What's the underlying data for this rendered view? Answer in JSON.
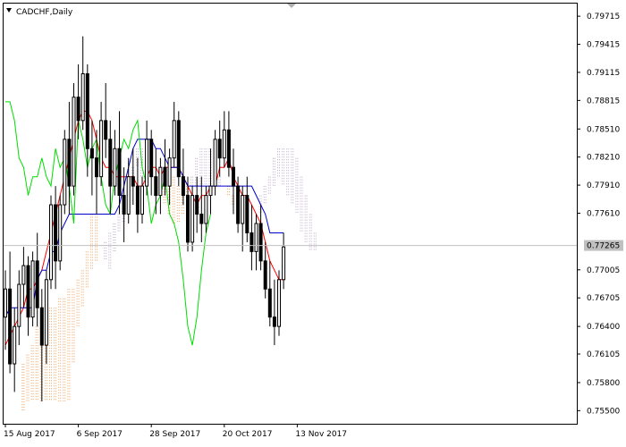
{
  "window": {
    "title": "CADCHF,Daily",
    "menu_icon": "triangle-down-icon",
    "scroll_marker_icon": "triangle-down-icon"
  },
  "colors": {
    "background": "#ffffff",
    "frame": "#000000",
    "candle": "#000000",
    "tenkan": "#ff0000",
    "kijun": "#0000cc",
    "chikou": "#00dd00",
    "cloud_bull": "#f0a060",
    "cloud_bear": "#b8a8c8",
    "bid_line": "#c0c0c0",
    "price_label_bg": "#c0c0c0"
  },
  "chart_data": {
    "type": "candlestick",
    "title": "CADCHF,Daily",
    "ylim": [
      0.7536,
      0.7985
    ],
    "y_ticks": [
      0.79715,
      0.79415,
      0.79115,
      0.78815,
      0.7851,
      0.7821,
      0.7791,
      0.7761,
      0.77005,
      0.76705,
      0.764,
      0.76105,
      0.758,
      0.755
    ],
    "current_price_label": "0.77265",
    "current_price": 0.77265,
    "x_labels": [
      "15 Aug 2017",
      "6 Sep 2017",
      "28 Sep 2017",
      "20 Oct 2017",
      "13 Nov 2017"
    ],
    "x_label_indices": [
      0,
      16,
      32,
      48,
      64
    ],
    "candles": [
      [
        0.765,
        0.77,
        0.7615,
        0.768
      ],
      [
        0.768,
        0.772,
        0.759,
        0.76
      ],
      [
        0.76,
        0.766,
        0.757,
        0.764
      ],
      [
        0.764,
        0.77,
        0.762,
        0.7685
      ],
      [
        0.7685,
        0.7725,
        0.766,
        0.7705
      ],
      [
        0.7705,
        0.7715,
        0.763,
        0.765
      ],
      [
        0.765,
        0.772,
        0.764,
        0.771
      ],
      [
        0.771,
        0.774,
        0.764,
        0.766
      ],
      [
        0.766,
        0.768,
        0.756,
        0.762
      ],
      [
        0.762,
        0.77,
        0.76,
        0.769
      ],
      [
        0.769,
        0.778,
        0.768,
        0.777
      ],
      [
        0.777,
        0.779,
        0.768,
        0.771
      ],
      [
        0.771,
        0.778,
        0.77,
        0.777
      ],
      [
        0.777,
        0.785,
        0.776,
        0.784
      ],
      [
        0.784,
        0.788,
        0.776,
        0.779
      ],
      [
        0.779,
        0.79,
        0.778,
        0.7885
      ],
      [
        0.7885,
        0.792,
        0.784,
        0.786
      ],
      [
        0.786,
        0.795,
        0.785,
        0.791
      ],
      [
        0.791,
        0.792,
        0.78,
        0.783
      ],
      [
        0.783,
        0.786,
        0.778,
        0.782
      ],
      [
        0.782,
        0.785,
        0.776,
        0.78
      ],
      [
        0.78,
        0.788,
        0.779,
        0.786
      ],
      [
        0.786,
        0.79,
        0.782,
        0.784
      ],
      [
        0.784,
        0.786,
        0.776,
        0.779
      ],
      [
        0.779,
        0.785,
        0.778,
        0.783
      ],
      [
        0.783,
        0.787,
        0.776,
        0.778
      ],
      [
        0.778,
        0.781,
        0.773,
        0.776
      ],
      [
        0.776,
        0.782,
        0.775,
        0.78
      ],
      [
        0.78,
        0.783,
        0.777,
        0.779
      ],
      [
        0.779,
        0.782,
        0.774,
        0.776
      ],
      [
        0.776,
        0.78,
        0.775,
        0.779
      ],
      [
        0.779,
        0.786,
        0.778,
        0.784
      ],
      [
        0.784,
        0.785,
        0.778,
        0.78
      ],
      [
        0.78,
        0.783,
        0.776,
        0.778
      ],
      [
        0.778,
        0.782,
        0.776,
        0.781
      ],
      [
        0.781,
        0.784,
        0.778,
        0.779
      ],
      [
        0.779,
        0.783,
        0.777,
        0.782
      ],
      [
        0.782,
        0.788,
        0.781,
        0.786
      ],
      [
        0.786,
        0.787,
        0.779,
        0.78
      ],
      [
        0.78,
        0.783,
        0.777,
        0.778
      ],
      [
        0.778,
        0.78,
        0.772,
        0.773
      ],
      [
        0.773,
        0.779,
        0.772,
        0.778
      ],
      [
        0.778,
        0.78,
        0.774,
        0.776
      ],
      [
        0.776,
        0.78,
        0.773,
        0.775
      ],
      [
        0.775,
        0.779,
        0.774,
        0.778
      ],
      [
        0.778,
        0.783,
        0.776,
        0.779
      ],
      [
        0.779,
        0.785,
        0.778,
        0.784
      ],
      [
        0.784,
        0.786,
        0.78,
        0.782
      ],
      [
        0.782,
        0.787,
        0.781,
        0.785
      ],
      [
        0.785,
        0.787,
        0.78,
        0.781
      ],
      [
        0.781,
        0.783,
        0.776,
        0.779
      ],
      [
        0.779,
        0.78,
        0.774,
        0.775
      ],
      [
        0.775,
        0.779,
        0.772,
        0.778
      ],
      [
        0.778,
        0.78,
        0.773,
        0.774
      ],
      [
        0.774,
        0.777,
        0.77,
        0.772
      ],
      [
        0.772,
        0.776,
        0.77,
        0.775
      ],
      [
        0.775,
        0.777,
        0.77,
        0.771
      ],
      [
        0.771,
        0.773,
        0.767,
        0.768
      ],
      [
        0.768,
        0.771,
        0.764,
        0.765
      ],
      [
        0.765,
        0.769,
        0.762,
        0.764
      ],
      [
        0.764,
        0.77,
        0.763,
        0.769
      ],
      [
        0.769,
        0.774,
        0.768,
        0.7725
      ]
    ],
    "series": [
      {
        "key": "tenkan",
        "values": [
          0.762,
          0.763,
          0.764,
          0.765,
          0.766,
          0.768,
          0.768,
          0.769,
          0.77,
          0.772,
          0.774,
          0.776,
          0.778,
          0.78,
          0.782,
          0.784,
          0.786,
          0.787,
          0.787,
          0.786,
          0.784,
          0.782,
          0.781,
          0.781,
          0.78,
          0.78,
          0.78,
          0.78,
          0.78,
          0.779,
          0.779,
          0.78,
          0.781,
          0.781,
          0.78,
          0.781,
          0.781,
          0.781,
          0.781,
          0.78,
          0.779,
          0.778,
          0.777,
          0.778,
          0.778,
          0.779,
          0.779,
          0.781,
          0.781,
          0.782,
          0.78,
          0.779,
          0.778,
          0.778,
          0.777,
          0.776,
          0.775,
          0.773,
          0.771,
          0.77,
          0.769,
          0.769
        ]
      },
      {
        "key": "kijun",
        "values": [
          0.765,
          0.766,
          0.766,
          0.766,
          0.766,
          0.766,
          0.766,
          0.769,
          0.77,
          0.77,
          0.772,
          0.772,
          0.774,
          0.775,
          0.776,
          0.776,
          0.776,
          0.776,
          0.776,
          0.776,
          0.776,
          0.776,
          0.776,
          0.776,
          0.776,
          0.777,
          0.779,
          0.781,
          0.783,
          0.784,
          0.784,
          0.784,
          0.784,
          0.783,
          0.783,
          0.782,
          0.781,
          0.781,
          0.781,
          0.78,
          0.779,
          0.779,
          0.779,
          0.779,
          0.779,
          0.779,
          0.779,
          0.779,
          0.779,
          0.779,
          0.779,
          0.779,
          0.779,
          0.779,
          0.779,
          0.778,
          0.777,
          0.776,
          0.774,
          0.774,
          0.774,
          0.774
        ]
      },
      {
        "key": "chikou",
        "values": [
          0.788,
          0.788,
          0.786,
          0.782,
          0.781,
          0.778,
          0.78,
          0.78,
          0.782,
          0.78,
          0.779,
          0.783,
          0.781,
          0.782,
          0.779,
          0.775,
          0.786,
          0.784,
          0.781,
          0.783,
          0.784,
          0.78,
          0.777,
          0.776,
          0.78,
          0.782,
          0.784,
          0.783,
          0.785,
          0.786,
          0.781,
          0.779,
          0.775,
          0.777,
          0.778,
          0.78,
          0.776,
          0.775,
          0.773,
          0.769,
          0.764,
          0.762,
          0.765,
          0.77,
          0.774,
          0.776
        ]
      }
    ],
    "cloud": {
      "start_index": 4,
      "senkou_a": [
        0.76,
        0.761,
        0.762,
        0.764,
        0.765,
        0.766,
        0.766,
        0.766,
        0.767,
        0.767,
        0.768,
        0.768,
        0.769,
        0.77,
        0.772,
        0.776,
        0.776,
        0.772,
        0.771,
        0.77,
        0.772,
        0.774,
        0.775,
        0.778,
        0.78,
        0.781,
        0.78,
        0.78,
        0.78,
        0.78,
        0.78,
        0.781,
        0.781,
        0.78,
        0.779,
        0.779,
        0.779,
        0.779,
        0.779,
        0.779,
        0.779,
        0.779,
        0.779,
        0.779,
        0.779,
        0.779,
        0.778,
        0.778,
        0.777,
        0.776,
        0.776,
        0.776,
        0.776,
        0.777,
        0.778,
        0.779,
        0.78,
        0.779,
        0.778,
        0.777,
        0.776,
        0.774,
        0.773,
        0.772,
        0.772,
        0.773
      ],
      "senkou_b": [
        0.755,
        0.756,
        0.756,
        0.756,
        0.756,
        0.756,
        0.756,
        0.756,
        0.756,
        0.756,
        0.756,
        0.76,
        0.764,
        0.766,
        0.768,
        0.77,
        0.771,
        0.772,
        0.773,
        0.774,
        0.775,
        0.776,
        0.777,
        0.779,
        0.781,
        0.783,
        0.783,
        0.781,
        0.78,
        0.779,
        0.778,
        0.777,
        0.776,
        0.775,
        0.775,
        0.776,
        0.778,
        0.78,
        0.782,
        0.783,
        0.783,
        0.783,
        0.782,
        0.78,
        0.779,
        0.778,
        0.777,
        0.776,
        0.776,
        0.776,
        0.776,
        0.776,
        0.778,
        0.779,
        0.78,
        0.782,
        0.783,
        0.783,
        0.783,
        0.783,
        0.782,
        0.78,
        0.778,
        0.776,
        0.774,
        0.773
      ]
    }
  }
}
